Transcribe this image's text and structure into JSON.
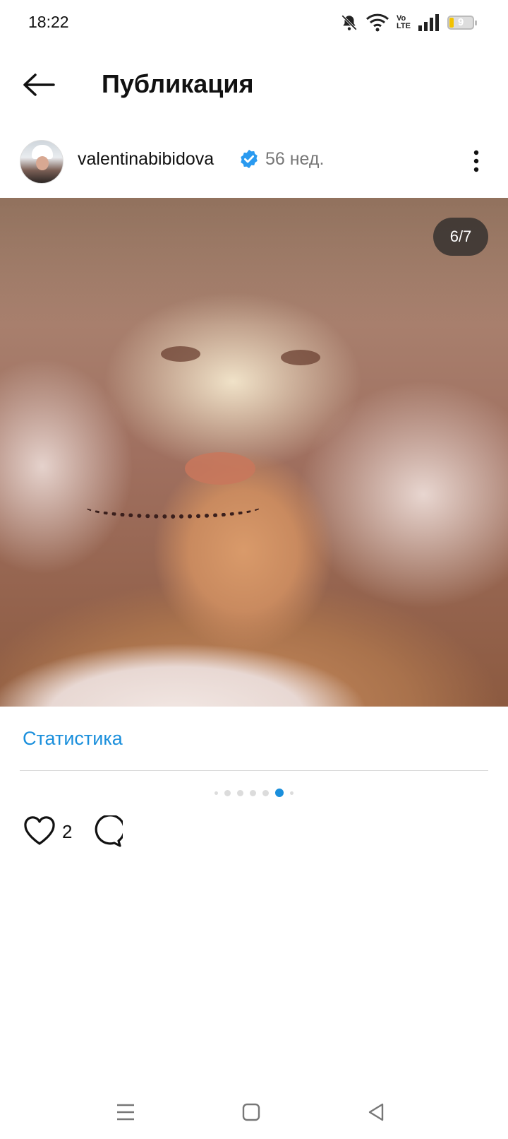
{
  "status_bar": {
    "time": "18:22",
    "volte": "Vo\nLTE",
    "battery": "9"
  },
  "header": {
    "title": "Публикация"
  },
  "post": {
    "username": "valentinabibidova",
    "time_ago": "56 нед.",
    "carousel_counter": "6/7",
    "carousel_total": 7,
    "carousel_current": 6,
    "stats_label": "Статистика",
    "likes_count": "2"
  },
  "colors": {
    "accent": "#1a8fdc"
  }
}
